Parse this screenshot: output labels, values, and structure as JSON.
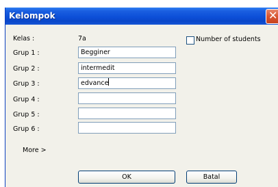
{
  "window": {
    "title": "Kelompok",
    "close_glyph": "✕"
  },
  "class_row": {
    "label": "Kelas :",
    "value": "7a"
  },
  "number_of_students": {
    "label": "Number of students",
    "checked": false
  },
  "groups": [
    {
      "label": "Grup 1 :",
      "value": "Begginer"
    },
    {
      "label": "Grup 2 :",
      "value": "intermedit"
    },
    {
      "label": "Grup 3 :",
      "value": "edvance"
    },
    {
      "label": "Grup 4 :",
      "value": ""
    },
    {
      "label": "Grup 5 :",
      "value": ""
    },
    {
      "label": "Grup 6 :",
      "value": ""
    }
  ],
  "more_link": "More >",
  "buttons": {
    "ok": "OK",
    "cancel": "Batal"
  },
  "colors": {
    "titlebar": "#0c4fd8",
    "close_button": "#d9552f",
    "dialog_background": "#f2f1ea",
    "input_border": "#7f9db9"
  }
}
